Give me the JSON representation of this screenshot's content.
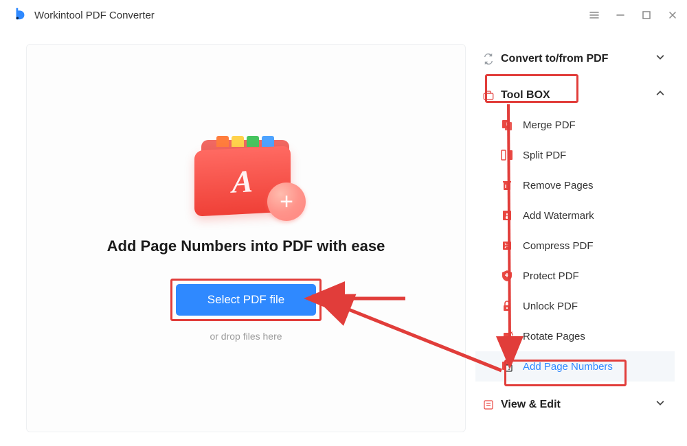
{
  "app": {
    "title": "Workintool PDF Converter"
  },
  "main": {
    "headline": "Add Page Numbers into PDF with ease",
    "select_button": "Select PDF file",
    "drop_hint": "or drop files here"
  },
  "sidebar": {
    "sections": {
      "convert": {
        "label": "Convert to/from PDF",
        "expanded": false
      },
      "toolbox": {
        "label": "Tool BOX",
        "expanded": true,
        "items": [
          {
            "label": "Merge PDF"
          },
          {
            "label": "Split PDF"
          },
          {
            "label": "Remove Pages"
          },
          {
            "label": "Add Watermark"
          },
          {
            "label": "Compress PDF"
          },
          {
            "label": "Protect PDF"
          },
          {
            "label": "Unlock PDF"
          },
          {
            "label": "Rotate Pages"
          },
          {
            "label": "Add Page Numbers"
          }
        ]
      },
      "viewedit": {
        "label": "View & Edit",
        "expanded": false
      }
    }
  }
}
